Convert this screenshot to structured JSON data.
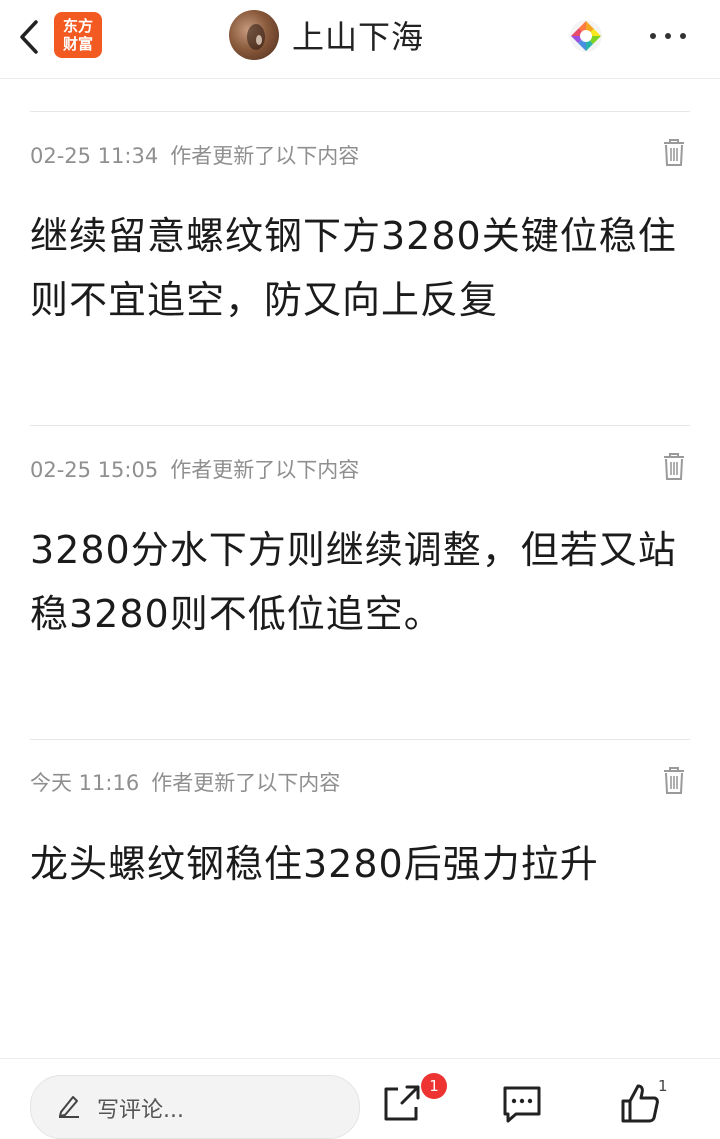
{
  "header": {
    "app_logo_line1": "东方",
    "app_logo_line2": "财富",
    "title": "上山下海"
  },
  "posts": [
    {
      "timestamp": "02-25 11:34",
      "note": "作者更新了以下内容",
      "content": "继续留意螺纹钢下方3280关键位稳住则不宜追空，防又向上反复"
    },
    {
      "timestamp": "02-25 15:05",
      "note": "作者更新了以下内容",
      "content": "3280分水下方则继续调整，但若又站稳3280则不低位追空。"
    },
    {
      "timestamp": "今天 11:16",
      "note": "作者更新了以下内容",
      "content": "龙头螺纹钢稳住3280后强力拉升"
    }
  ],
  "footer": {
    "comment_placeholder": "写评论...",
    "share_badge": "1",
    "like_count": "1"
  },
  "icons": {
    "back": "chevron-left-icon",
    "camera": "shutter-icon",
    "more": "more-dots-icon",
    "delete": "trash-icon",
    "pen": "pen-icon",
    "share": "share-icon",
    "message": "message-icon",
    "like": "thumbs-up-icon"
  },
  "colors": {
    "brand": "#f25a22",
    "badge": "#ee3333",
    "meta_text": "#8f8f8f"
  }
}
